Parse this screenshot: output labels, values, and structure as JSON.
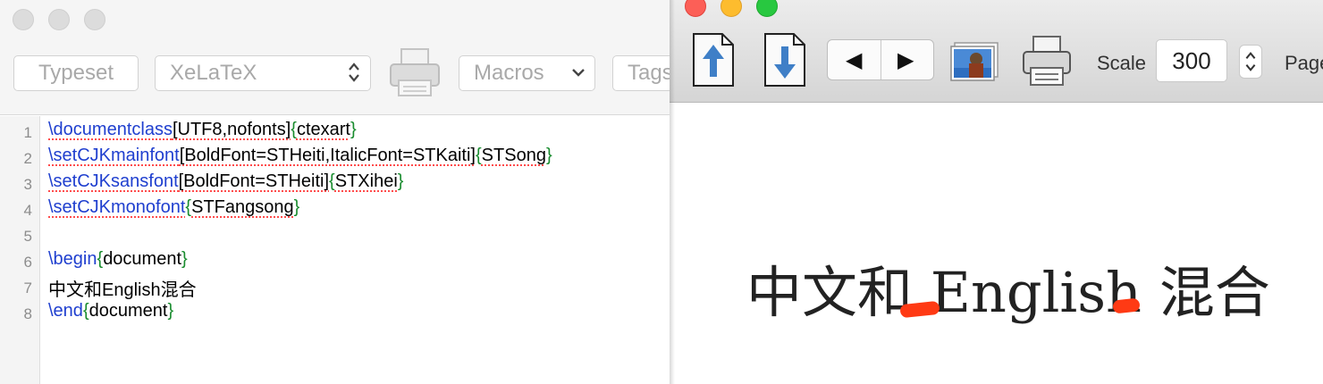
{
  "left_toolbar": {
    "typeset_label": "Typeset",
    "engine_value": "XeLaTeX",
    "macros_label": "Macros",
    "tags_label": "Tags"
  },
  "editor": {
    "line_numbers": [
      "1",
      "2",
      "3",
      "4",
      "5",
      "6",
      "7",
      "8"
    ],
    "lines": [
      {
        "cmd": "\\documentclass",
        "opt": "[UTF8,nofonts]",
        "lb": "{",
        "arg": "ctexart",
        "rb": "}"
      },
      {
        "cmd": "\\setCJKmainfont",
        "opt": "[BoldFont=STHeiti,ItalicFont=STKaiti]",
        "lb": "{",
        "arg": "STSong",
        "rb": "}"
      },
      {
        "cmd": "\\setCJKsansfont",
        "opt": "[BoldFont=STHeiti]",
        "lb": "{",
        "arg": "STXihei",
        "rb": "}"
      },
      {
        "cmd": "\\setCJKmonofont",
        "lb": "{",
        "arg": "STFangsong",
        "rb": "}"
      },
      {},
      {
        "cmd": "\\begin",
        "lb": "{",
        "arg": "document",
        "rb": "}"
      },
      {
        "text": "中文和English混合"
      },
      {
        "cmd": "\\end",
        "lb": "{",
        "arg": "document",
        "rb": "}"
      }
    ]
  },
  "preview": {
    "scale_label": "Scale",
    "scale_value": "300",
    "page_label": "Page",
    "prev_arrow": "◀",
    "next_arrow": "▶",
    "document_text": "中文和 English 混合",
    "icons": [
      "page-up-icon",
      "page-down-icon",
      "photo-icon",
      "print-icon"
    ],
    "accent_colors": {
      "annotation": "#ff3a14",
      "keyword": "#1f3fcf",
      "brace": "#198c2e",
      "traffic_red": "#fc5f57",
      "traffic_yellow": "#fdbc2e",
      "traffic_green": "#28c840"
    }
  }
}
